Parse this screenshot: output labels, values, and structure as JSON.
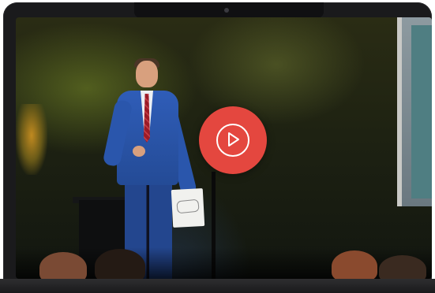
{
  "video": {
    "play_control": {
      "icon": "play-icon",
      "color": "#e4473f"
    }
  },
  "colors": {
    "bezel": "#1a1a1c",
    "accent": "#e4473f"
  }
}
